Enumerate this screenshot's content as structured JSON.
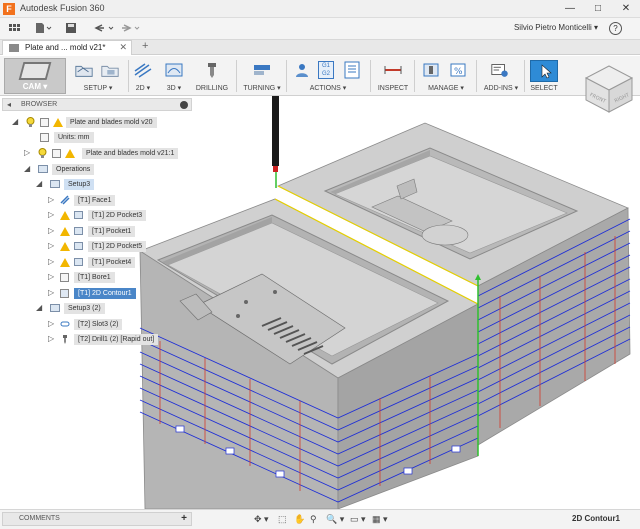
{
  "titlebar": {
    "app_icon": "F",
    "title": "Autodesk Fusion 360",
    "minimize": "—",
    "maximize": "□",
    "close": "✕"
  },
  "quickbar": {
    "user": "Silvio Pietro Monticelli ▾",
    "help": "?"
  },
  "doc_tab": {
    "label": "Plate and ... mold v21*",
    "close": "✕",
    "new": "+"
  },
  "toolbar": {
    "workspace": "CAM ▾",
    "groups": [
      {
        "label": "SETUP ▾"
      },
      {
        "label": "2D ▾"
      },
      {
        "label": "3D ▾"
      },
      {
        "label": "DRILLING"
      },
      {
        "label": "TURNING ▾"
      },
      {
        "label": "ACTIONS ▾"
      },
      {
        "label": "INSPECT"
      },
      {
        "label": "MANAGE ▾"
      },
      {
        "label": "ADD-INS ▾"
      },
      {
        "label": "SELECT"
      }
    ],
    "g1": "G1",
    "g2": "G2"
  },
  "viewcube": {
    "front": "FRONT",
    "right": "RIGHT"
  },
  "browser": {
    "header": "BROWSER",
    "collapse_arrow": "◂",
    "nodes": [
      {
        "label": "Plate and blades mold v20"
      },
      {
        "label": "Units: mm"
      },
      {
        "label": "Plate and blades mold v21:1"
      },
      {
        "label": "Operations"
      },
      {
        "label": "Setup3"
      },
      {
        "label": "[T1] Face1"
      },
      {
        "label": "[T1] 2D Pocket3"
      },
      {
        "label": "[T1] Pocket1"
      },
      {
        "label": "[T1] 2D Pocket5"
      },
      {
        "label": "[T1] Pocket4"
      },
      {
        "label": "[T1] Bore1"
      },
      {
        "label": "[T1] 2D Contour1"
      },
      {
        "label": "Setup3 (2)"
      },
      {
        "label": "[T2] Slot3 (2)"
      },
      {
        "label": "[T2] Drill1 (2) [Rapid out]"
      }
    ]
  },
  "bottom": {
    "comments": "COMMENTS",
    "comments_add": "+",
    "status": "2D Contour1",
    "nav_icons": [
      "✥ ▾",
      "⬚",
      "✋",
      "⚲",
      "🔍 ▾",
      "▭ ▾",
      "▦ ▾"
    ]
  },
  "colors": {
    "accent": "#2e8bd6",
    "selection": "#4a86c8",
    "toolpath_blue": "#1f2fd6",
    "toolpath_red": "#d43a2a",
    "part_grey": "#c4c4c4",
    "warning": "#f2b600"
  }
}
